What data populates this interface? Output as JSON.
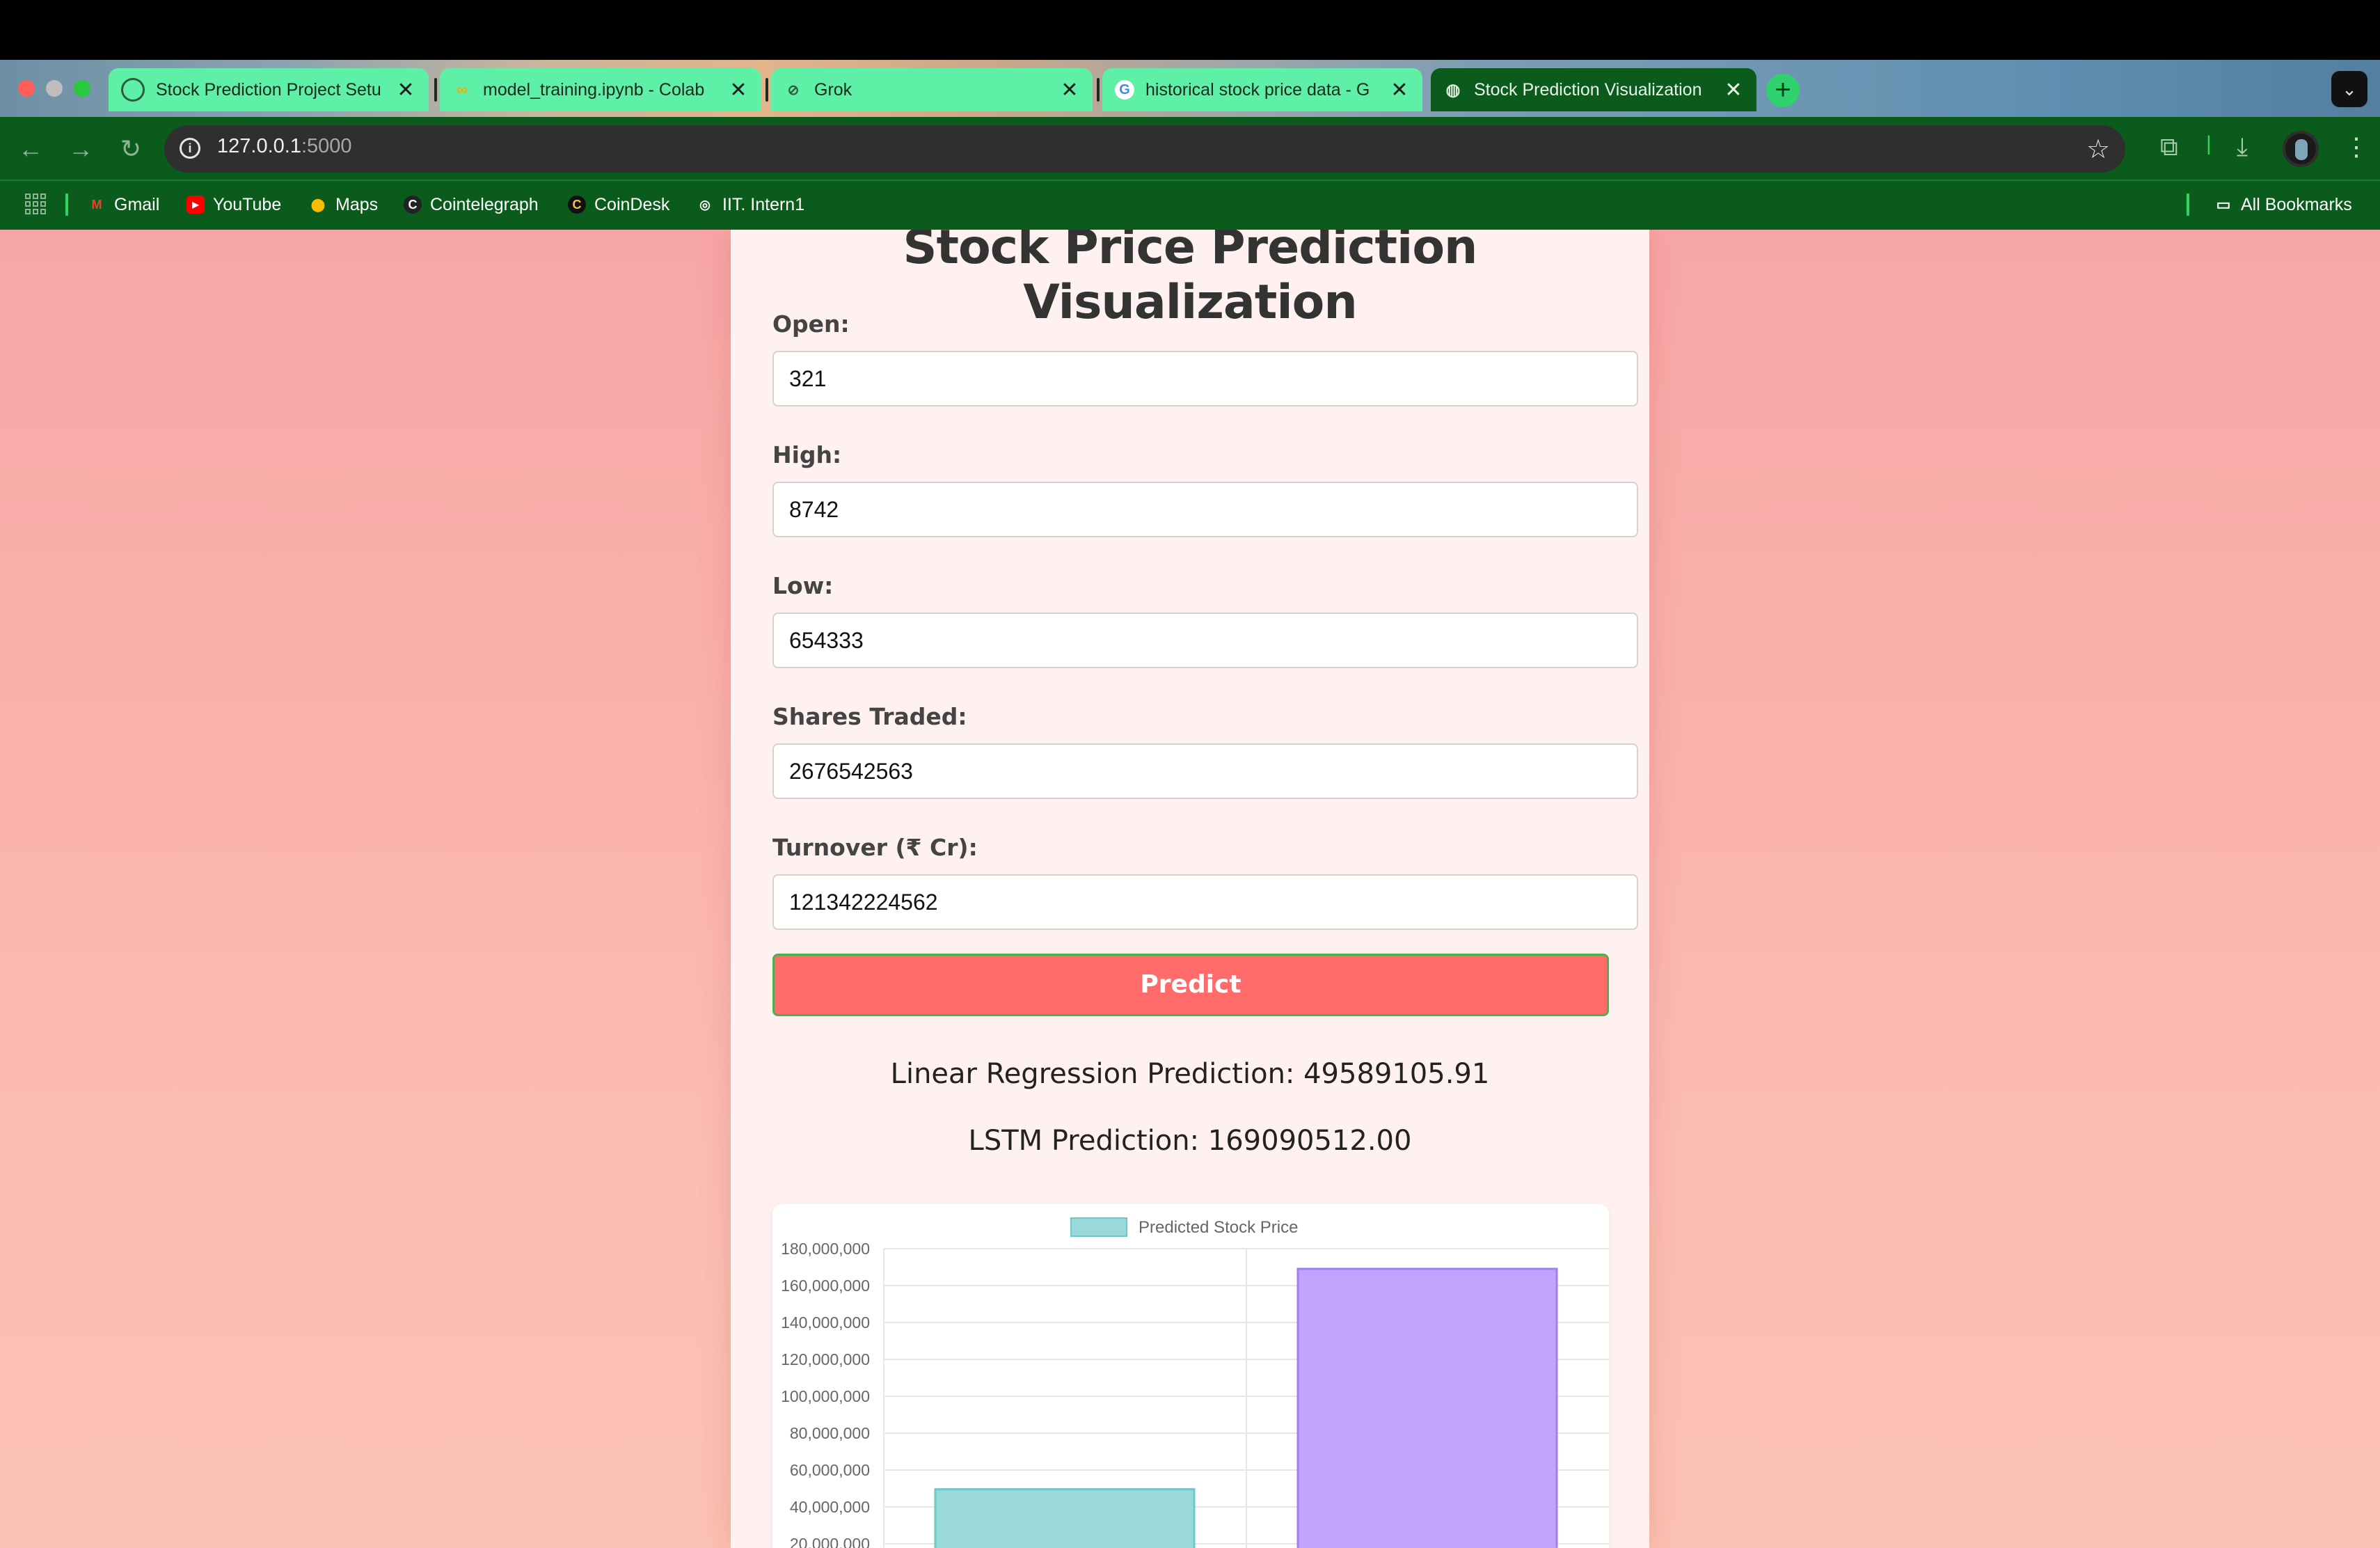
{
  "browser": {
    "tabs": [
      {
        "title": "Stock Prediction Project Setu",
        "icon": "chatgpt-icon",
        "active": false
      },
      {
        "title": "model_training.ipynb - Colab",
        "icon": "colab-icon",
        "active": false
      },
      {
        "title": "Grok",
        "icon": "grok-icon",
        "active": false
      },
      {
        "title": "historical stock price data - G",
        "icon": "google-icon",
        "active": false
      },
      {
        "title": "Stock Prediction Visualization",
        "icon": "globe-icon",
        "active": true
      }
    ],
    "address": {
      "host": "127.0.0.1",
      "port": ":5000"
    },
    "bookmarks": [
      "Gmail",
      "YouTube",
      "Maps",
      "Cointelegraph",
      "CoinDesk",
      "IIT. Intern1"
    ],
    "all_bookmarks": "All Bookmarks"
  },
  "page": {
    "title": "Stock Price Prediction Visualization",
    "fields": [
      {
        "label": "Open:",
        "value": "321"
      },
      {
        "label": "High:",
        "value": "8742"
      },
      {
        "label": "Low:",
        "value": "654333"
      },
      {
        "label": "Shares Traded:",
        "value": "2676542563"
      },
      {
        "label": "Turnover (₹ Cr):",
        "value": "121342224562"
      }
    ],
    "predict_label": "Predict",
    "results": {
      "linear": "Linear Regression Prediction: 49589105.91",
      "lstm": "LSTM Prediction: 169090512.00"
    }
  },
  "chart_data": {
    "type": "bar",
    "series": [
      {
        "name": "Predicted Stock Price",
        "values": [
          49589105.91,
          169090512.0
        ]
      }
    ],
    "values": [
      49589105.91,
      169090512.0
    ],
    "colors": [
      "#9ad9d9",
      "#c4a3ff"
    ],
    "borders": [
      "#70c7c7",
      "#a27cf4"
    ],
    "yticks": [
      "180,000,000",
      "160,000,000",
      "140,000,000",
      "120,000,000",
      "100,000,000",
      "80,000,000",
      "60,000,000",
      "40,000,000",
      "20,000,000"
    ],
    "ylim": [
      0,
      180000000
    ],
    "legend": "top"
  }
}
